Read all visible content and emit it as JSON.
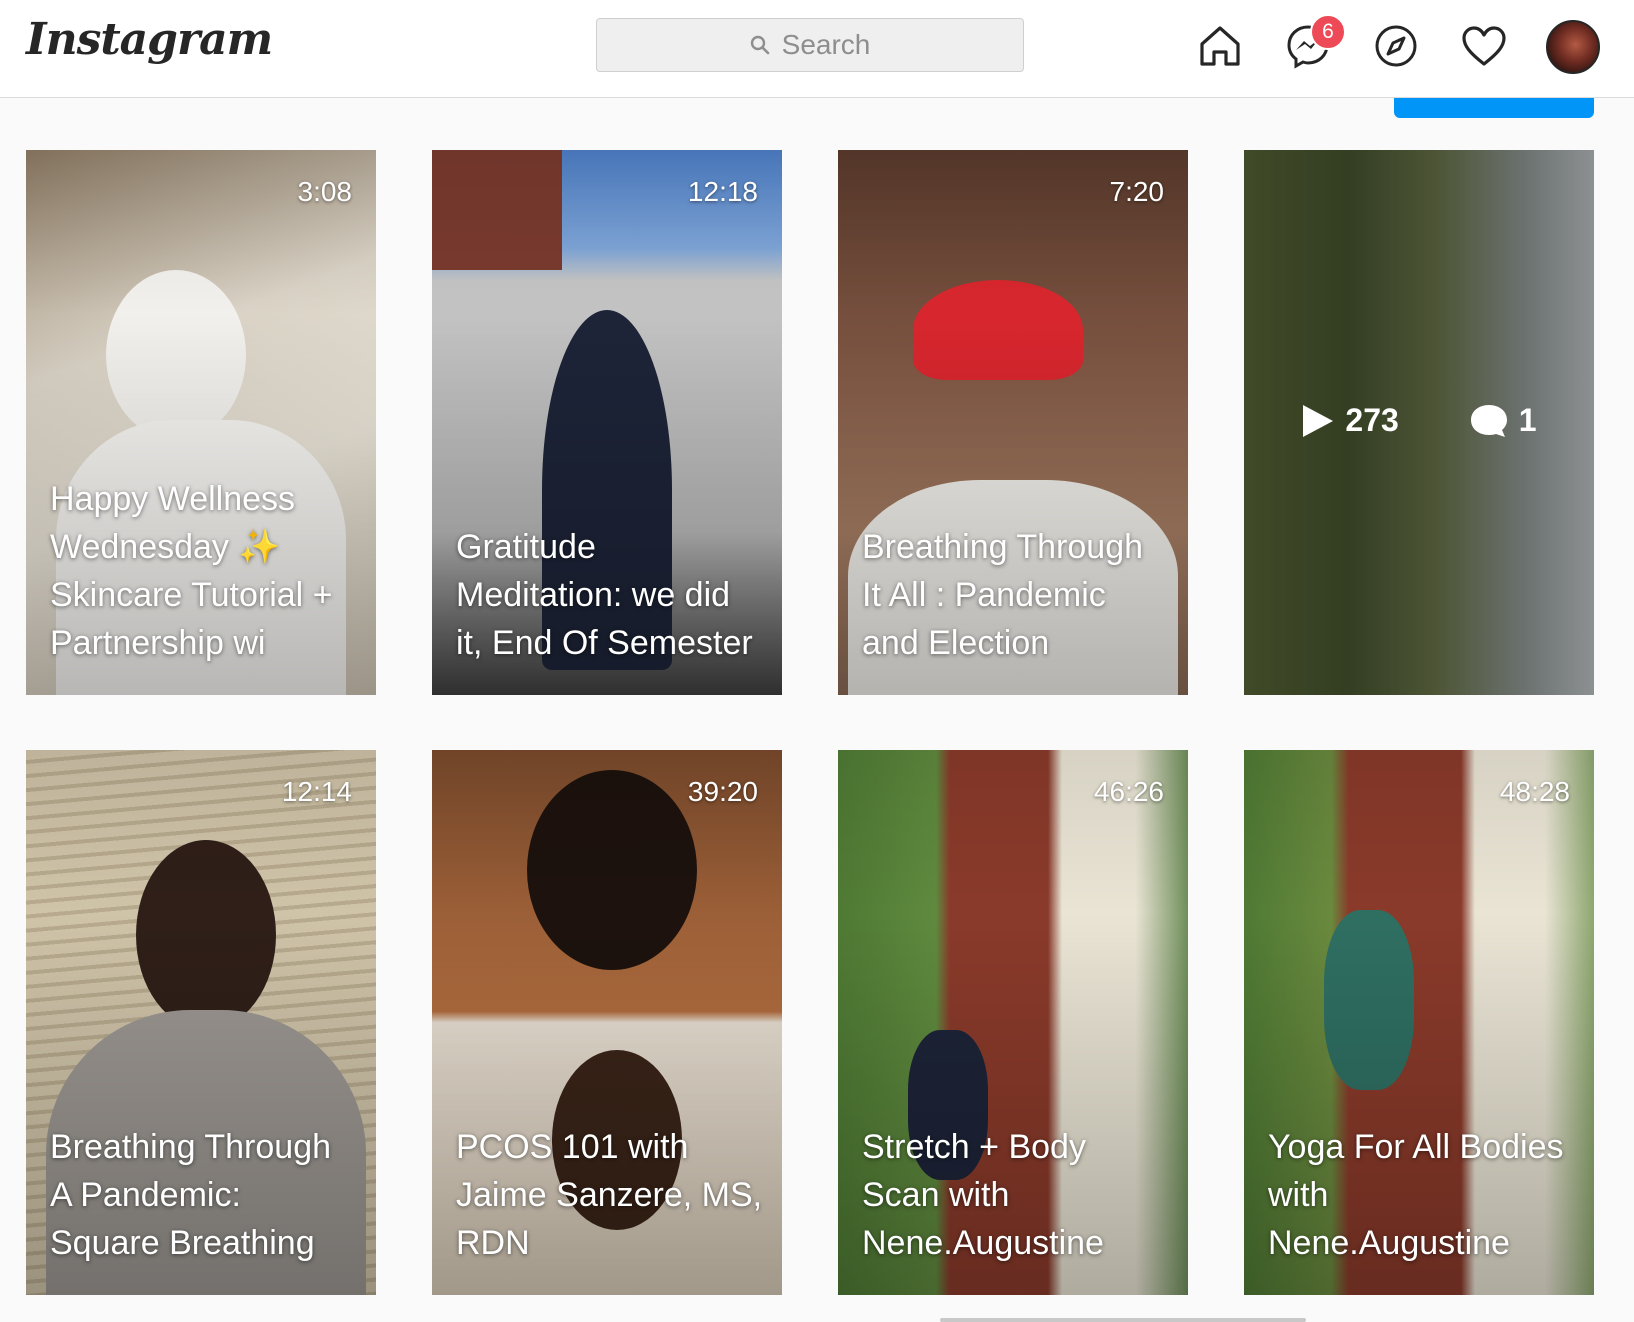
{
  "header": {
    "logo_text": "Instagram",
    "search_placeholder": "Search",
    "messenger_badge_count": "6",
    "icons": [
      "home-icon",
      "messenger-icon",
      "explore-icon",
      "heart-icon"
    ]
  },
  "videos": [
    {
      "duration": "3:08",
      "caption": "Happy Wellness Wednesday ✨ Skincare Tutorial + Partnership wi"
    },
    {
      "duration": "12:18",
      "caption": "Gratitude Meditation: we did it, End Of Semester"
    },
    {
      "duration": "7:20",
      "caption": "Breathing Through It All : Pandemic and Election"
    },
    {
      "hover_views": "273",
      "hover_comments": "1"
    },
    {
      "duration": "12:14",
      "caption": "Breathing Through A Pandemic: Square Breathing"
    },
    {
      "duration": "39:20",
      "caption": "PCOS 101 with Jaime Sanzere, MS, RDN"
    },
    {
      "duration": "46:26",
      "caption": "Stretch + Body Scan with Nene.Augustine"
    },
    {
      "duration": "48:28",
      "caption": "Yoga For All Bodies with Nene.Augustine"
    }
  ],
  "colors": {
    "accent": "#0095f6",
    "badge": "#ed4956"
  }
}
